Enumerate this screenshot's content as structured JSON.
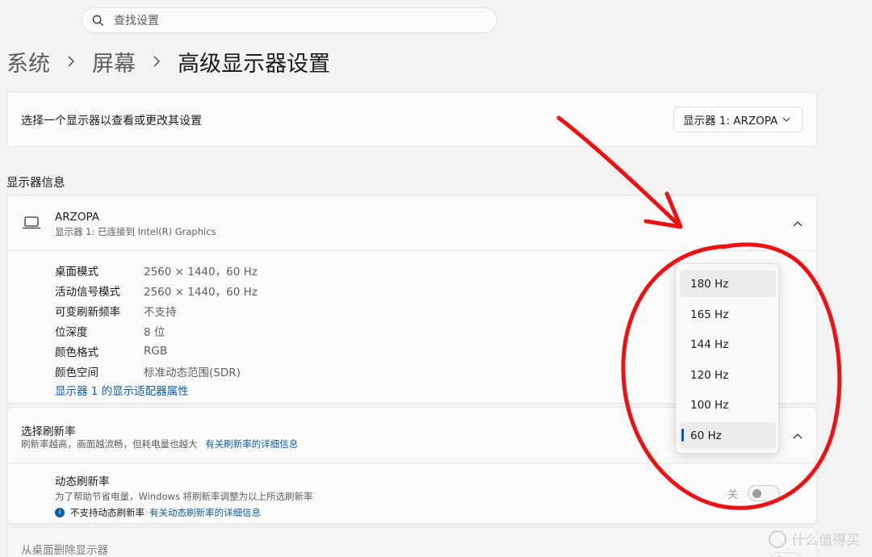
{
  "search": {
    "placeholder": "查找设置"
  },
  "breadcrumb": {
    "level1": "系统",
    "level2": "屏幕",
    "current": "高级显示器设置"
  },
  "display_select": {
    "label": "选择一个显示器以查看或更改其设置",
    "selected": "显示器 1: ARZOPA"
  },
  "section": {
    "display_info_title": "显示器信息"
  },
  "monitor": {
    "name": "ARZOPA",
    "subtitle": "显示器 1: 已连接到 Intel(R) Graphics",
    "rows": [
      {
        "key": "桌面模式",
        "value": "2560 × 1440，60 Hz"
      },
      {
        "key": "活动信号模式",
        "value": "2560 × 1440，60 Hz"
      },
      {
        "key": "可变刷新频率",
        "value": "不支持"
      },
      {
        "key": "位深度",
        "value": "8 位"
      },
      {
        "key": "颜色格式",
        "value": "RGB"
      },
      {
        "key": "颜色空间",
        "value": "标准动态范围(SDR)"
      }
    ],
    "adapter_link": "显示器 1 的显示适配器属性"
  },
  "refresh": {
    "title": "选择刷新率",
    "desc": "刷新率越高，画面越流畅，但耗电量也越大",
    "desc_link": "有关刷新率的详细信息",
    "options": [
      "180 Hz",
      "165 Hz",
      "144 Hz",
      "120 Hz",
      "100 Hz",
      "60 Hz"
    ],
    "selected": "60 Hz",
    "hovered": "180 Hz"
  },
  "dynamic_refresh": {
    "title": "动态刷新率",
    "desc": "为了帮助节省电量，Windows 将刷新率调整为以上所选刷新率",
    "note": "不支持动态刷新率",
    "note_link": "有关动态刷新率的详细信息",
    "toggle_label": "关",
    "toggle_on": false
  },
  "remove_display": {
    "title": "从桌面删除显示器",
    "desc": ""
  },
  "watermark": {
    "text": "什么值得买"
  },
  "colors": {
    "accent": "#0b5fa8",
    "annotation": "#ee1111",
    "background": "#f3f3f3",
    "card": "#fbfbfb"
  }
}
